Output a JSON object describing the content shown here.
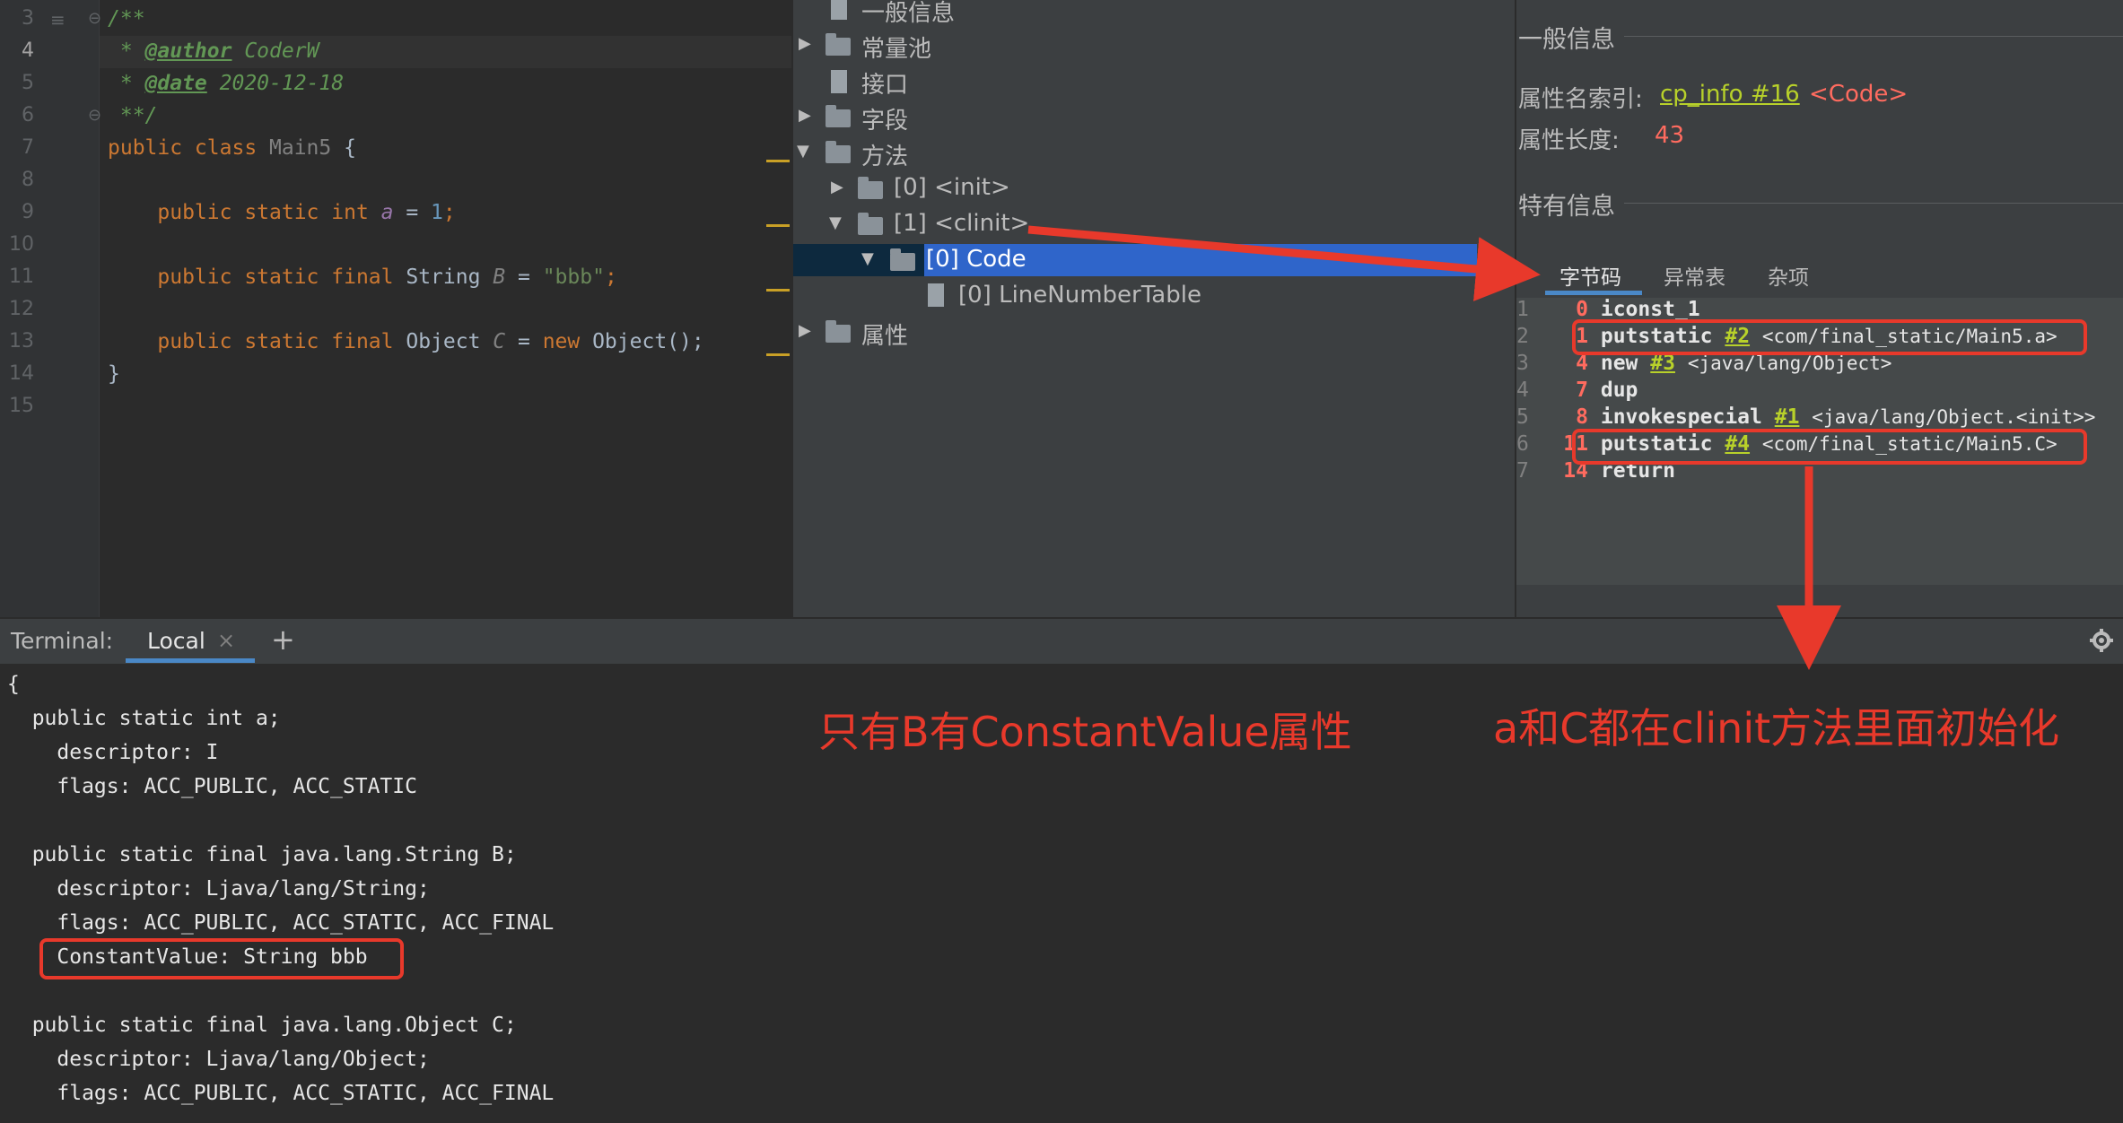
{
  "editor": {
    "line_numbers": [
      "3",
      "4",
      "5",
      "6",
      "7",
      "8",
      "9",
      "10",
      "11",
      "12",
      "13",
      "14",
      "15"
    ],
    "lines": {
      "l3": "/**",
      "l4_prefix": " * ",
      "l4_tag": "@author",
      "l4_val": " CoderW",
      "l5_prefix": " * ",
      "l5_tag": "@date",
      "l5_val": " 2020-12-18",
      "l6": " **/",
      "l7_kw": "public class ",
      "l7_name": "Main5",
      "l7_rest": " {",
      "l9_kw": "    public static int ",
      "l9_fld": "a",
      "l9_eq": " = ",
      "l9_num": "1",
      "l9_semi": ";",
      "l11_kw": "    public static final ",
      "l11_type": "String ",
      "l11_fld": "B",
      "l11_eq": " = ",
      "l11_str": "\"bbb\"",
      "l11_semi": ";",
      "l13_kw": "    public static final ",
      "l13_type": "Object ",
      "l13_fld": "C",
      "l13_eq": " = ",
      "l13_new": "new ",
      "l13_ctor": "Object();",
      "l14": "}"
    }
  },
  "tree": {
    "items": [
      {
        "label": "一般信息"
      },
      {
        "label": "常量池"
      },
      {
        "label": "接口"
      },
      {
        "label": "字段"
      },
      {
        "label": "方法"
      },
      {
        "label": "[0] <init>"
      },
      {
        "label": "[1] <clinit>"
      },
      {
        "label": "[0] Code"
      },
      {
        "label": "[0] LineNumberTable"
      },
      {
        "label": "属性"
      }
    ]
  },
  "info": {
    "general_title": "一般信息",
    "attr_name_key": "属性名索引:",
    "attr_name_link": "cp_info #16",
    "attr_name_value": "<Code>",
    "attr_len_key": "属性长度:",
    "attr_len_value": "43",
    "specific_title": "特有信息",
    "tabs": [
      "字节码",
      "异常表",
      "杂项"
    ],
    "bytecode": [
      {
        "idx": "1",
        "off": "0",
        "op": "iconst_1",
        "ref": "",
        "comment": ""
      },
      {
        "idx": "2",
        "off": "1",
        "op": "putstatic",
        "ref": "#2",
        "comment": "<com/final_static/Main5.a>"
      },
      {
        "idx": "3",
        "off": "4",
        "op": "new",
        "ref": "#3",
        "comment": "<java/lang/Object>"
      },
      {
        "idx": "4",
        "off": "7",
        "op": "dup",
        "ref": "",
        "comment": ""
      },
      {
        "idx": "5",
        "off": "8",
        "op": "invokespecial",
        "ref": "#1",
        "comment": "<java/lang/Object.<init>>"
      },
      {
        "idx": "6",
        "off": "11",
        "op": "putstatic",
        "ref": "#4",
        "comment": "<com/final_static/Main5.C>"
      },
      {
        "idx": "7",
        "off": "14",
        "op": "return",
        "ref": "",
        "comment": ""
      }
    ]
  },
  "terminal": {
    "label": "Terminal:",
    "tab": "Local",
    "close": "×",
    "add": "+",
    "lines": [
      "{",
      "  public static int a;",
      "    descriptor: I",
      "    flags: ACC_PUBLIC, ACC_STATIC",
      "",
      "  public static final java.lang.String B;",
      "    descriptor: Ljava/lang/String;",
      "    flags: ACC_PUBLIC, ACC_STATIC, ACC_FINAL",
      "    ConstantValue: String bbb",
      "",
      "  public static final java.lang.Object C;",
      "    descriptor: Ljava/lang/Object;",
      "    flags: ACC_PUBLIC, ACC_STATIC, ACC_FINAL"
    ]
  },
  "annotations": {
    "left": "只有B有ConstantValue属性",
    "right": "a和C都在clinit方法里面初始化"
  },
  "colors": {
    "annotation": "#e8392b",
    "selection": "#2f65ca",
    "link": "#b8d12a"
  }
}
